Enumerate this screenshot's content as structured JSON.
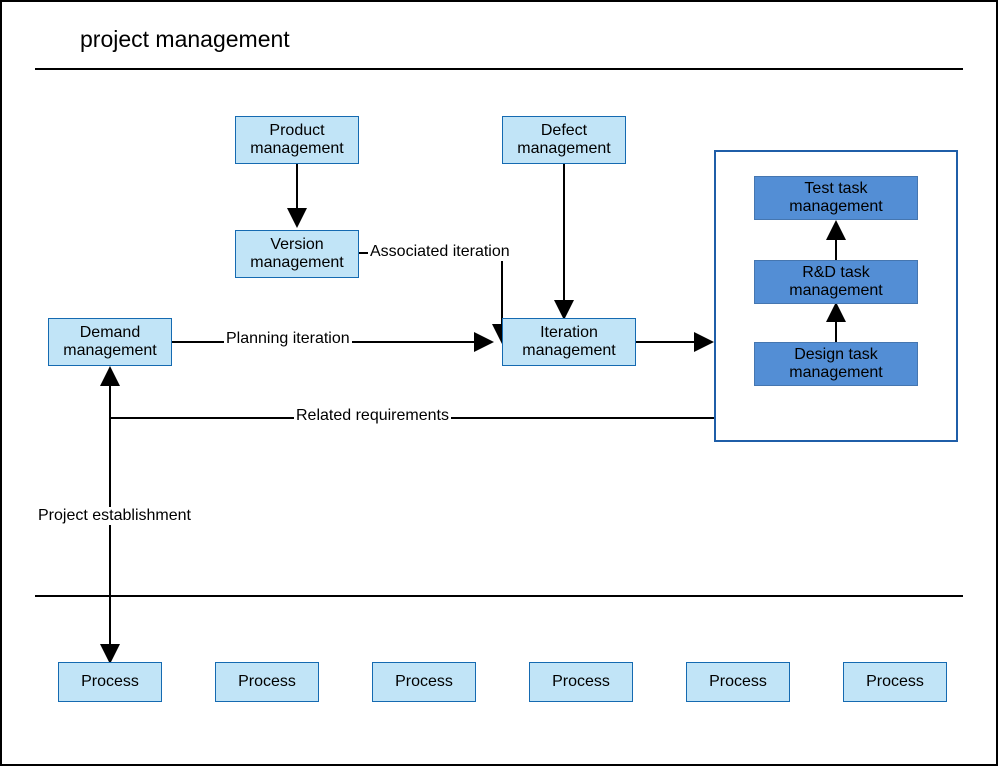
{
  "title": "project management",
  "nodes": {
    "demand": "Demand management",
    "product": "Product management",
    "version": "Version management",
    "defect": "Defect management",
    "iteration": "Iteration management",
    "test": "Test task management",
    "rnd": "R&D task management",
    "design": "Design task management"
  },
  "edges": {
    "planning": "Planning iteration",
    "associated": "Associated iteration",
    "related": "Related requirements",
    "establish": "Project establishment"
  },
  "processes": [
    "Process",
    "Process",
    "Process",
    "Process",
    "Process",
    "Process"
  ]
}
